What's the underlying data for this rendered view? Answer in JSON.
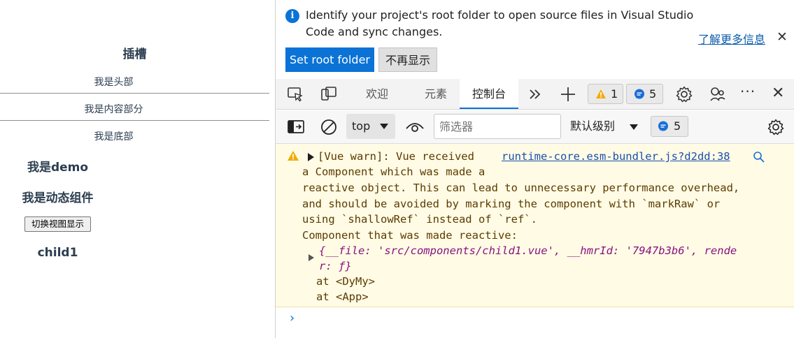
{
  "preview": {
    "slot_title": "插槽",
    "header_text": "我是头部",
    "content_text": "我是内容部分",
    "footer_text": "我是底部",
    "demo_title": "我是demo",
    "dynamic_title": "我是动态组件",
    "toggle_button": "切换视图显示",
    "child_title": "child1"
  },
  "banner": {
    "icon": "info-icon",
    "message": "Identify your project's root folder to open source files in Visual Studio Code and sync changes.",
    "learn_more": "了解更多信息",
    "set_root": "Set root folder",
    "dont_show": "不再显示"
  },
  "tabs": {
    "welcome": "欢迎",
    "elements": "元素",
    "console": "控制台",
    "warnings_count": "1",
    "messages_count": "5"
  },
  "console_toolbar": {
    "context": "top",
    "filter_placeholder": "筛选器",
    "levels": "默认级别",
    "messages_count": "5"
  },
  "warning": {
    "line1": "[Vue warn]: Vue received",
    "source_link": "runtime-core.esm-bundler.js?d2dd:38",
    "line2": "a Component which was made a",
    "line3": "reactive object. This can lead to unnecessary performance overhead,",
    "line4": "and should be avoided by marking the component with `markRaw` or",
    "line5": "using `shallowRef` instead of `ref`.",
    "line6": "Component that was made reactive:",
    "object_line1": "{__file: 'src/components/child1.vue', __hmrId: '7947b3b6', rende",
    "object_line2": "r: ƒ}",
    "trace1": "at <DyMy>",
    "trace2": "at <App>"
  },
  "colors": {
    "accent": "#0b73d6",
    "warning_bg": "#fffbe5",
    "warning_text": "#5c3b00"
  }
}
